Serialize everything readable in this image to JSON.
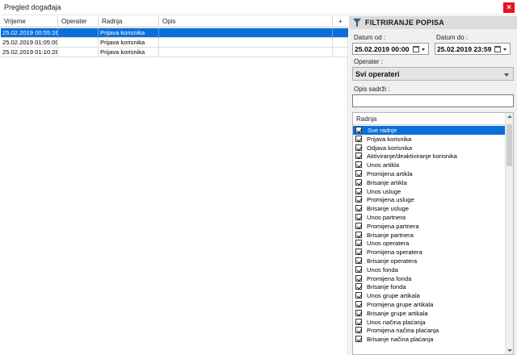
{
  "window": {
    "title": "Pregled događaja",
    "close_glyph": "×"
  },
  "grid": {
    "columns": [
      "Vrijeme",
      "Operater",
      "Radnja",
      "Opis",
      "+"
    ],
    "rows": [
      {
        "vrijeme": "25.02.2019 00:55:26",
        "operater": "",
        "radnja": "Prijava korisnika",
        "opis": ""
      },
      {
        "vrijeme": "25.02.2019 01:05:00",
        "operater": "",
        "radnja": "Prijava korisnika",
        "opis": ""
      },
      {
        "vrijeme": "25.02.2019 01:10:28",
        "operater": "",
        "radnja": "Prijava korisnika",
        "opis": ""
      }
    ],
    "selected_row": 0
  },
  "filter": {
    "title": "FILTRIRANJE POPISA",
    "icon": "filter-icon",
    "datum_od_label": "Datum od :",
    "datum_od_value": "25.02.2019 00:00",
    "datum_do_label": "Datum do :",
    "datum_do_value": "25.02.2019 23:59",
    "operater_label": "Operater :",
    "operater_value": "Svi operateri",
    "opis_label": "Opis sadrži :",
    "opis_value": "",
    "radnja_header": "Radnja",
    "radnja_items": [
      "Sve radnje",
      "Prijava korisnika",
      "Odjava korisnika",
      "Aktiviranje/deaktiviranje korisnika",
      "Unos artikla",
      "Promijena artikla",
      "Brisanje artikla",
      "Unos usluge",
      "Promijena usluge",
      "Brisanje usluge",
      "Unos partnera",
      "Promijena partnera",
      "Brisanje partnera",
      "Unos operatera",
      "Promijena operatera",
      "Brisanje operatera",
      "Unos fonda",
      "Promijena fonda",
      "Brisanje fonda",
      "Unos grupe artikala",
      "Promijena grupe artikala",
      "Brisanje grupe artikala",
      "Unos načina plaćanja",
      "Promijena načina plaćanja",
      "Brisanje načina plaćanja"
    ],
    "selected_item": 0
  },
  "colors": {
    "accent": "#0a6fd9",
    "close": "#e81123",
    "panel_bg": "#f0f0f0",
    "header_bg": "#dcdcdc"
  }
}
